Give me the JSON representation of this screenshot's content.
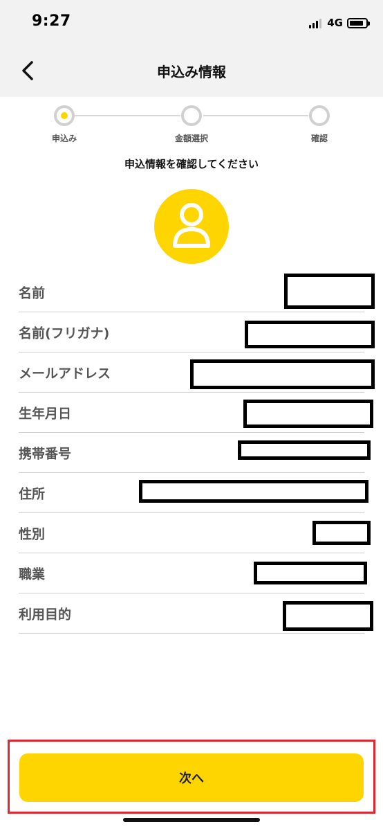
{
  "status_bar": {
    "time": "9:27",
    "network": "4G",
    "battery_level": 0.85
  },
  "nav": {
    "title": "申込み情報",
    "back_icon": "chevron-left-icon"
  },
  "stepper": {
    "steps": [
      {
        "label": "申込み",
        "active": true
      },
      {
        "label": "金額選択",
        "active": false
      },
      {
        "label": "確認",
        "active": false
      }
    ]
  },
  "subheading": "申込情報を確認してください",
  "avatar_icon": "person-icon",
  "fields": [
    {
      "label": "名前"
    },
    {
      "label": "名前(フリガナ)"
    },
    {
      "label": "メールアドレス"
    },
    {
      "label": "生年月日"
    },
    {
      "label": "携帯番号"
    },
    {
      "label": "住所"
    },
    {
      "label": "性別"
    },
    {
      "label": "職業"
    },
    {
      "label": "利用目的"
    }
  ],
  "next_button": {
    "label": "次へ"
  },
  "colors": {
    "accent": "#ffd500",
    "highlight_border": "#e0262f",
    "header_bg": "#f2f2f2"
  }
}
